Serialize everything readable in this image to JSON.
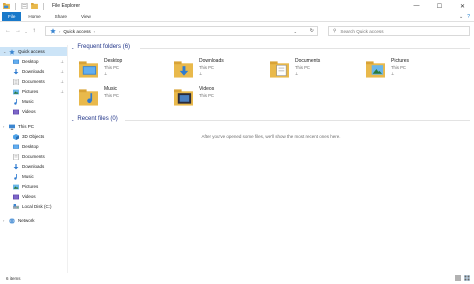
{
  "window": {
    "title": "File Explorer",
    "minimize": "—",
    "maximize": "☐",
    "close": "✕"
  },
  "ribbon": {
    "tabs": [
      "File",
      "Home",
      "Share",
      "View"
    ],
    "expand": "⌄",
    "help": "?"
  },
  "nav": {
    "back": "←",
    "forward": "→",
    "recent": "⌄",
    "up": "↑",
    "address": "Quick access",
    "address_chevron": "›",
    "address_end_chevron": "›",
    "dropdown": "⌄",
    "refresh": "↻",
    "search_icon": "⚲",
    "search_placeholder": "Search Quick access"
  },
  "sidebar": {
    "items": [
      {
        "label": "Quick access",
        "icon": "star-icon",
        "pinned": false
      },
      {
        "label": "Desktop",
        "icon": "desktop-icon",
        "pinned": true
      },
      {
        "label": "Downloads",
        "icon": "downloads-icon",
        "pinned": true
      },
      {
        "label": "Documents",
        "icon": "documents-icon",
        "pinned": true
      },
      {
        "label": "Pictures",
        "icon": "pictures-icon",
        "pinned": true
      },
      {
        "label": "Music",
        "icon": "music-icon",
        "pinned": false
      },
      {
        "label": "Videos",
        "icon": "videos-icon",
        "pinned": false
      },
      {
        "label": "This PC",
        "icon": "computer-icon",
        "pinned": false
      },
      {
        "label": "3D Objects",
        "icon": "cube-icon",
        "pinned": false
      },
      {
        "label": "Desktop",
        "icon": "desktop-icon",
        "pinned": false
      },
      {
        "label": "Documents",
        "icon": "documents-icon",
        "pinned": false
      },
      {
        "label": "Downloads",
        "icon": "downloads-icon",
        "pinned": false
      },
      {
        "label": "Music",
        "icon": "music-icon",
        "pinned": false
      },
      {
        "label": "Pictures",
        "icon": "pictures-icon",
        "pinned": false
      },
      {
        "label": "Videos",
        "icon": "videos-icon",
        "pinned": false
      },
      {
        "label": "Local Disk (C:)",
        "icon": "drive-icon",
        "pinned": false
      },
      {
        "label": "Network",
        "icon": "network-icon",
        "pinned": false
      }
    ],
    "pin_glyph": "⊥",
    "expander": "›"
  },
  "frequent": {
    "header": "Frequent folders (6)",
    "folders": [
      {
        "name": "Desktop",
        "location": "This PC",
        "icon": "desktop-folder-icon"
      },
      {
        "name": "Downloads",
        "location": "This PC",
        "icon": "downloads-folder-icon"
      },
      {
        "name": "Documents",
        "location": "This PC",
        "icon": "documents-folder-icon"
      },
      {
        "name": "Pictures",
        "location": "This PC",
        "icon": "pictures-folder-icon"
      },
      {
        "name": "Music",
        "location": "This PC",
        "icon": "music-folder-icon"
      },
      {
        "name": "Videos",
        "location": "This PC",
        "icon": "videos-folder-icon"
      }
    ],
    "pin_glyph": "⊥"
  },
  "recent": {
    "header": "Recent files (0)",
    "empty_message": "After you've opened some files, we'll show the most recent ones here."
  },
  "status": {
    "count": "6 items"
  },
  "colors": {
    "accent": "#1979ca",
    "selection": "#cce4f7",
    "header_text": "#1e3287",
    "folder": "#e9b94b"
  }
}
